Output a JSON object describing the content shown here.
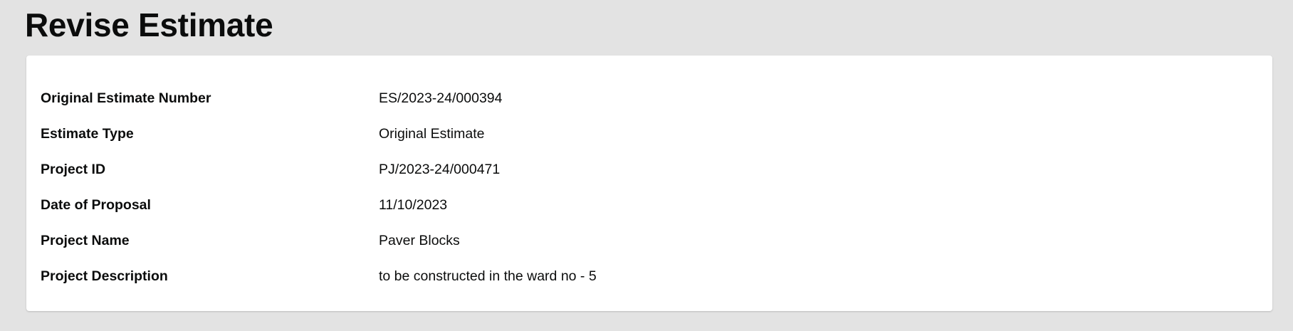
{
  "page": {
    "title": "Revise Estimate"
  },
  "details": [
    {
      "label": "Original Estimate Number",
      "value": "ES/2023-24/000394"
    },
    {
      "label": "Estimate Type",
      "value": "Original Estimate"
    },
    {
      "label": "Project ID",
      "value": "PJ/2023-24/000471"
    },
    {
      "label": "Date of Proposal",
      "value": "11/10/2023"
    },
    {
      "label": "Project Name",
      "value": "Paver Blocks"
    },
    {
      "label": "Project Description",
      "value": "to be constructed in the ward no - 5"
    }
  ],
  "colors": {
    "background": "#e3e3e3",
    "card": "#ffffff",
    "text": "#0b0c0c"
  }
}
